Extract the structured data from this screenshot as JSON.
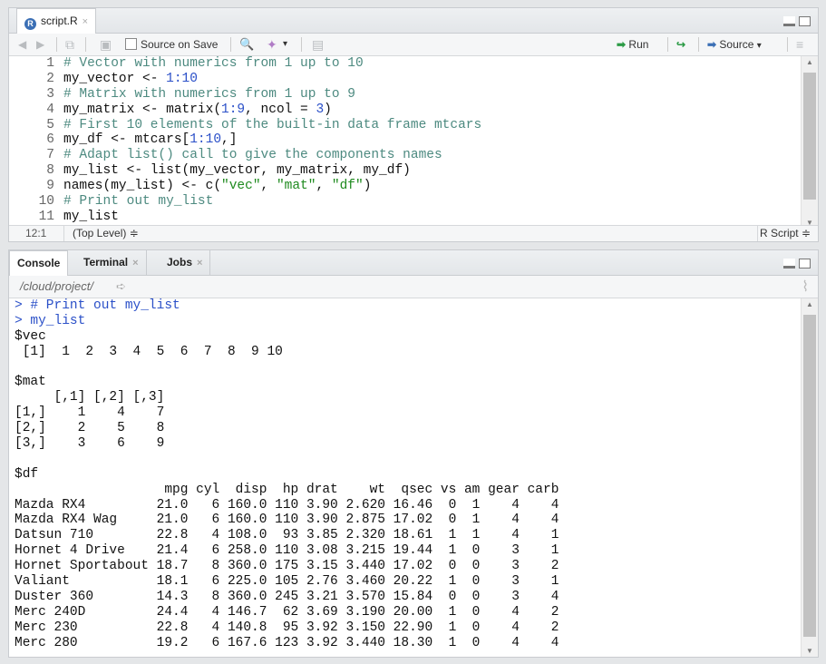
{
  "editor": {
    "tab": {
      "icon": "R",
      "label": "script.R"
    },
    "toolbar": {
      "source_on_save": "Source on Save",
      "run": "Run",
      "source": "Source"
    },
    "line_numbers": [
      "1",
      "2",
      "3",
      "4",
      "5",
      "6",
      "7",
      "8",
      "9",
      "10",
      "11"
    ],
    "lines": [
      [
        {
          "t": "# Vector with numerics from 1 up to 10",
          "c": "cmt"
        }
      ],
      [
        {
          "t": "my_vector <- ",
          "c": "plain"
        },
        {
          "t": "1:10",
          "c": "num"
        }
      ],
      [
        {
          "t": "# Matrix with numerics from 1 up to 9",
          "c": "cmt"
        }
      ],
      [
        {
          "t": "my_matrix <- matrix(",
          "c": "plain"
        },
        {
          "t": "1:9",
          "c": "num"
        },
        {
          "t": ", ncol = ",
          "c": "plain"
        },
        {
          "t": "3",
          "c": "num"
        },
        {
          "t": ")",
          "c": "plain"
        }
      ],
      [
        {
          "t": "# First 10 elements of the built-in data frame mtcars",
          "c": "cmt"
        }
      ],
      [
        {
          "t": "my_df <- mtcars[",
          "c": "plain"
        },
        {
          "t": "1:10",
          "c": "num"
        },
        {
          "t": ",]",
          "c": "plain"
        }
      ],
      [
        {
          "t": "# Adapt list() call to give the components names",
          "c": "cmt"
        }
      ],
      [
        {
          "t": "my_list <- list(my_vector, my_matrix, my_df)",
          "c": "plain"
        }
      ],
      [
        {
          "t": "names(my_list) <- c(",
          "c": "plain"
        },
        {
          "t": "\"vec\"",
          "c": "str"
        },
        {
          "t": ", ",
          "c": "plain"
        },
        {
          "t": "\"mat\"",
          "c": "str"
        },
        {
          "t": ", ",
          "c": "plain"
        },
        {
          "t": "\"df\"",
          "c": "str"
        },
        {
          "t": ")",
          "c": "plain"
        }
      ],
      [
        {
          "t": "# Print out my_list",
          "c": "cmt"
        }
      ],
      [
        {
          "t": "my_list",
          "c": "plain"
        }
      ]
    ],
    "status": {
      "position": "12:1",
      "scope": "(Top Level) ≑",
      "filetype": "R Script ≑"
    }
  },
  "console": {
    "tabs": [
      "Console",
      "Terminal",
      "Jobs"
    ],
    "path": "/cloud/project/",
    "lines": [
      {
        "t": "> # Print out my_list",
        "c": "prompt"
      },
      {
        "t": "> my_list",
        "c": "prompt"
      },
      {
        "t": "$vec",
        "c": "out"
      },
      {
        "t": " [1]  1  2  3  4  5  6  7  8  9 10",
        "c": "out"
      },
      {
        "t": "",
        "c": "out"
      },
      {
        "t": "$mat",
        "c": "out"
      },
      {
        "t": "     [,1] [,2] [,3]",
        "c": "out"
      },
      {
        "t": "[1,]    1    4    7",
        "c": "out"
      },
      {
        "t": "[2,]    2    5    8",
        "c": "out"
      },
      {
        "t": "[3,]    3    6    9",
        "c": "out"
      },
      {
        "t": "",
        "c": "out"
      },
      {
        "t": "$df",
        "c": "out"
      },
      {
        "t": "                   mpg cyl  disp  hp drat    wt  qsec vs am gear carb",
        "c": "out"
      },
      {
        "t": "Mazda RX4         21.0   6 160.0 110 3.90 2.620 16.46  0  1    4    4",
        "c": "out"
      },
      {
        "t": "Mazda RX4 Wag     21.0   6 160.0 110 3.90 2.875 17.02  0  1    4    4",
        "c": "out"
      },
      {
        "t": "Datsun 710        22.8   4 108.0  93 3.85 2.320 18.61  1  1    4    1",
        "c": "out"
      },
      {
        "t": "Hornet 4 Drive    21.4   6 258.0 110 3.08 3.215 19.44  1  0    3    1",
        "c": "out"
      },
      {
        "t": "Hornet Sportabout 18.7   8 360.0 175 3.15 3.440 17.02  0  0    3    2",
        "c": "out"
      },
      {
        "t": "Valiant           18.1   6 225.0 105 2.76 3.460 20.22  1  0    3    1",
        "c": "out"
      },
      {
        "t": "Duster 360        14.3   8 360.0 245 3.21 3.570 15.84  0  0    3    4",
        "c": "out"
      },
      {
        "t": "Merc 240D         24.4   4 146.7  62 3.69 3.190 20.00  1  0    4    2",
        "c": "out"
      },
      {
        "t": "Merc 230          22.8   4 140.8  95 3.92 3.150 22.90  1  0    4    2",
        "c": "out"
      },
      {
        "t": "Merc 280          19.2   6 167.6 123 3.92 3.440 18.30  1  0    4    4",
        "c": "out"
      }
    ]
  },
  "icons": {
    "back": "◀",
    "forward": "▶",
    "search": "🔍",
    "wand": "✦",
    "run_arrow": "➡",
    "rerun": "↪",
    "source_arrow": "➡",
    "close": "×",
    "dropdown": "▾",
    "outline": "≡",
    "broom": "⌇",
    "scroll_up": "▲",
    "scroll_down": "▼",
    "path_arrow": "➪"
  },
  "colors": {
    "comment": "#4d8a80",
    "number": "#2b50c8",
    "string": "#1e8a1e",
    "prompt": "#2b50c8"
  }
}
